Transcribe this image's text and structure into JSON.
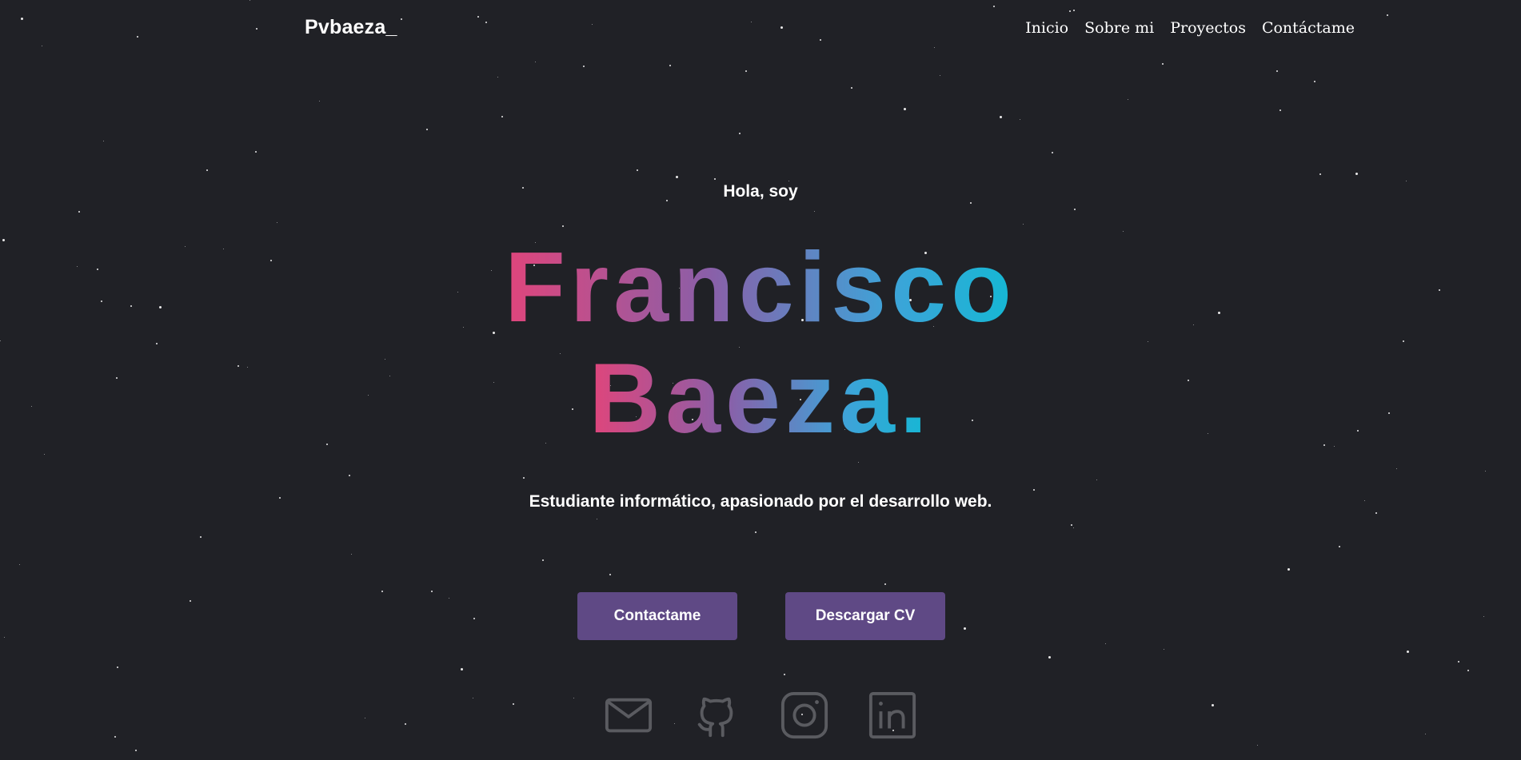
{
  "navbar": {
    "logo": "Pvbaeza_",
    "links": [
      "Inicio",
      "Sobre mi",
      "Proyectos",
      "Contáctame"
    ]
  },
  "hero": {
    "greeting": "Hola, soy",
    "first_name": "Francisco",
    "last_name": "Baeza.",
    "tagline": "Estudiante informático, apasionado por el desarrollo web."
  },
  "buttons": {
    "contact": "Contactame",
    "download_cv": "Descargar CV"
  },
  "socials": [
    {
      "icon": "mail-icon"
    },
    {
      "icon": "github-icon"
    },
    {
      "icon": "instagram-icon"
    },
    {
      "icon": "linkedin-icon"
    }
  ],
  "colors": {
    "background": "#202126",
    "button": "#5f4985",
    "gradient_start": "#e0457b",
    "gradient_end": "#14b8d4",
    "icon_gray": "#5a5b60"
  }
}
